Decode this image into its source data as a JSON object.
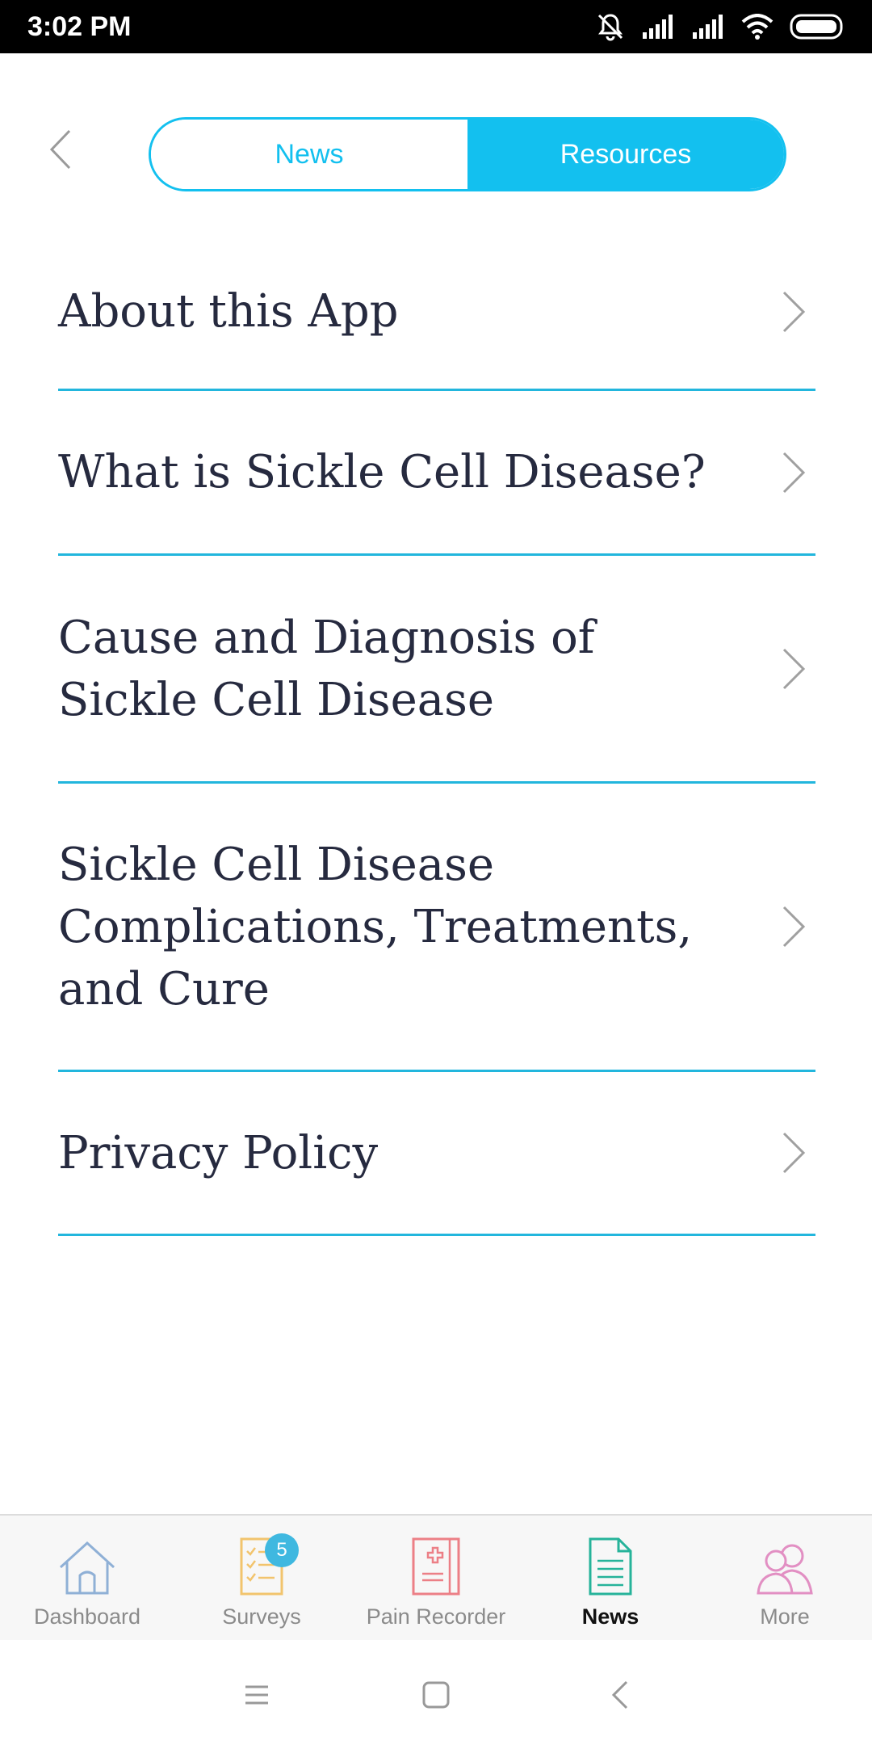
{
  "status_bar": {
    "time": "3:02 PM"
  },
  "header": {
    "segments": [
      {
        "label": "News",
        "active": false
      },
      {
        "label": "Resources",
        "active": true
      }
    ]
  },
  "resources": {
    "items": [
      {
        "label": "About this App"
      },
      {
        "label": "What is Sickle Cell Disease?"
      },
      {
        "label": "Cause and Diagnosis of Sickle Cell Disease"
      },
      {
        "label": "Sickle Cell Disease Complications, Treatments, and Cure"
      },
      {
        "label": "Privacy Policy"
      }
    ]
  },
  "tabbar": {
    "tabs": [
      {
        "label": "Dashboard",
        "icon": "house-icon"
      },
      {
        "label": "Surveys",
        "icon": "checklist-icon",
        "badge": "5"
      },
      {
        "label": "Pain Recorder",
        "icon": "medical-notebook-icon"
      },
      {
        "label": "News",
        "icon": "document-icon",
        "active": true
      },
      {
        "label": "More",
        "icon": "people-icon"
      }
    ]
  },
  "colors": {
    "accent": "#13c0ef",
    "divider": "#22b6dd",
    "text": "#262a3f"
  }
}
